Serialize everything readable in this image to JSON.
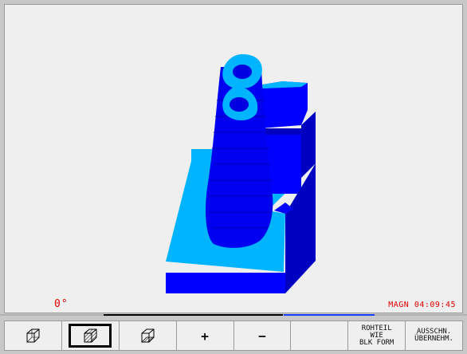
{
  "viewport": {
    "angle_label": "0°",
    "status_text": "MAGN 04:09:45",
    "colors": {
      "top_face": "#00b4ff",
      "side_face": "#0000ff",
      "dark_face": "#0000c0",
      "text": "#e00000"
    }
  },
  "softkeys": [
    {
      "id": "view-1",
      "icon": "cube-wireframe-icon",
      "label": ""
    },
    {
      "id": "view-2",
      "icon": "cube-hatched-icon",
      "label": "",
      "selected": true
    },
    {
      "id": "view-3",
      "icon": "cube-bottom-hatched-icon",
      "label": ""
    },
    {
      "id": "zoom-in",
      "icon": "",
      "label": "+"
    },
    {
      "id": "zoom-out",
      "icon": "",
      "label": "−"
    },
    {
      "id": "blank",
      "icon": "",
      "label": ""
    },
    {
      "id": "blank-form",
      "icon": "",
      "label": "ROHTEIL\nWIE\nBLK FORM"
    },
    {
      "id": "apply-cutout",
      "icon": "",
      "label": "AUSSCHN.\nÜBERNEHM."
    }
  ]
}
